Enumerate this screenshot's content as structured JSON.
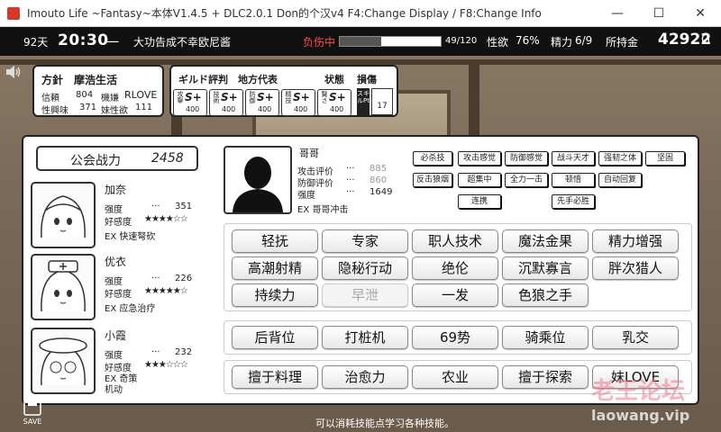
{
  "window": {
    "title": "Imouto Life ~Fantasy~本体V1.4.5 + DLC2.0.1 Don的个汉v4     F4:Change Display / F8:Change Info",
    "minimize": "—",
    "maximize": "☐",
    "close": "✕"
  },
  "status": {
    "day": "92天",
    "time": "20:30",
    "dash": "一",
    "event": "大功告成不幸欧尼酱",
    "injury_label": "负伤中",
    "hp_text": "49/120",
    "hp_fraction": 0.408,
    "lust_label": "性欲",
    "lust_value": "76%",
    "energy_label": "精力",
    "energy_value": "6/9",
    "money_label": "所持金",
    "money_value": "42922",
    "money_unit": "G"
  },
  "info": {
    "policy_label": "方針",
    "policy_value": "摩浩生活",
    "trust_label": "信頼",
    "trust_value": "804",
    "mood_label": "機嫌",
    "mood_value": "RLOVE",
    "interest_label": "性興味",
    "interest_value": "371",
    "sister_label": "妹性欲",
    "sister_value": "111"
  },
  "guild": {
    "label": "ギルド評判",
    "region_label": "地方代表",
    "state_label": "状態",
    "state_value": "損傷",
    "ranks": [
      {
        "side": "攻撃",
        "grade": "S+",
        "pts": "400"
      },
      {
        "side": "技術",
        "grade": "S+",
        "pts": "400"
      },
      {
        "side": "防御",
        "grade": "S+",
        "pts": "400"
      },
      {
        "side": "精技",
        "grade": "S+",
        "pts": "400"
      },
      {
        "side": "賢さ",
        "grade": "S+",
        "pts": "400"
      }
    ],
    "skill_pt_label": "スキルPt",
    "skill_pt_value": "17"
  },
  "party": {
    "power_label": "公会战力",
    "power_value": "2458",
    "members": [
      {
        "name": "加奈",
        "str_label": "强度",
        "str_dots": "···",
        "str_value": "351",
        "fav_label": "好感度",
        "stars": "★★★★☆☆",
        "ex": "EX 快速弩砍"
      },
      {
        "name": "优衣",
        "str_label": "强度",
        "str_dots": "···",
        "str_value": "226",
        "fav_label": "好感度",
        "stars": "★★★★★☆",
        "ex": "EX 应急治疗"
      },
      {
        "name": "小霞",
        "str_label": "强度",
        "str_dots": "···",
        "str_value": "232",
        "fav_label": "好感度",
        "stars": "★★★☆☆☆",
        "ex": "EX 奇策\n机动"
      }
    ]
  },
  "hero": {
    "name": "哥哥",
    "atk_label": "攻击评价",
    "atk_value": "885",
    "def_label": "防御评价",
    "def_value": "860",
    "str_label": "强度",
    "str_value": "1649",
    "dots": "···",
    "ex": "EX 哥哥冲击",
    "tags": [
      "必杀技",
      "攻击感觉",
      "防御感觉",
      "战斗天才",
      "强韧之体",
      "坚固",
      "反击狼烟",
      "超集中",
      "全力一击",
      "顿悟",
      "自动回复",
      "连携",
      "先手必胜"
    ]
  },
  "skills": {
    "group1": [
      "轻抚",
      "专家",
      "职人技术",
      "魔法金果",
      "精力增强",
      "高潮射精",
      "隐秘行动",
      "绝伦",
      "沉默寡言",
      "胖次猎人",
      "持续力",
      "早泄",
      "一发",
      "色狼之手"
    ],
    "group2": [
      "后背位",
      "打桩机",
      "69势",
      "骑乘位",
      "乳交"
    ],
    "group3": [
      "擅于料理",
      "治愈力",
      "农业",
      "擅于探索",
      "妹LOVE"
    ]
  },
  "footer": {
    "hint": "可以消耗技能点学习各种技能。",
    "save_label": "SAVE",
    "watermark": "老王论坛",
    "watermark_url": "laowang.vip"
  }
}
